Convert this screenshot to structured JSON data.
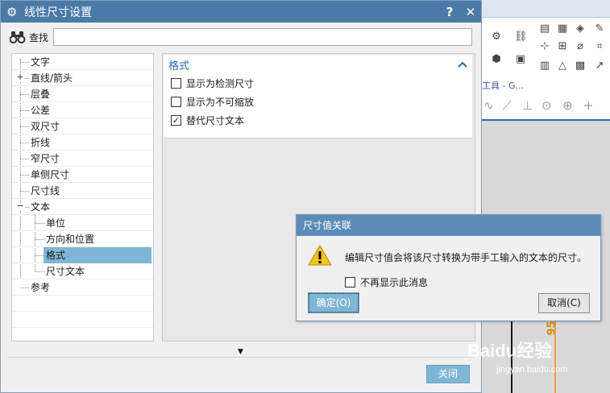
{
  "dialog": {
    "title": "线性尺寸设置",
    "help_label": "?",
    "close_label": "✕"
  },
  "search": {
    "label": "查找",
    "value": ""
  },
  "tree": {
    "items": [
      {
        "label": "文字",
        "level": 0
      },
      {
        "label": "直线/箭头",
        "level": 0,
        "expander": "+"
      },
      {
        "label": "层叠",
        "level": 0
      },
      {
        "label": "公差",
        "level": 0
      },
      {
        "label": "双尺寸",
        "level": 0
      },
      {
        "label": "折线",
        "level": 0
      },
      {
        "label": "窄尺寸",
        "level": 0
      },
      {
        "label": "单侧尺寸",
        "level": 0
      },
      {
        "label": "尺寸线",
        "level": 0
      },
      {
        "label": "文本",
        "level": 0,
        "expander": "−"
      },
      {
        "label": "单位",
        "level": 1
      },
      {
        "label": "方向和位置",
        "level": 1
      },
      {
        "label": "格式",
        "level": 1,
        "selected": true
      },
      {
        "label": "尺寸文本",
        "level": 1
      },
      {
        "label": "参考",
        "level": 0
      }
    ]
  },
  "format_group": {
    "title": "格式",
    "options": [
      {
        "label": "显示为检测尺寸",
        "checked": false
      },
      {
        "label": "显示为不可缩放",
        "checked": false
      },
      {
        "label": "替代尺寸文本",
        "checked": true
      }
    ]
  },
  "footer": {
    "close_label": "关闭"
  },
  "message": {
    "title": "尺寸值关联",
    "text": "编辑尺寸值会将该尺寸转换为带手工输入的文本的尺寸。",
    "checkbox_label": "不再显示此消息",
    "ok_label": "确定(O)",
    "cancel_label": "取消(C)"
  },
  "background": {
    "toolbar_label": "工具 - G...",
    "watermark_text": "Baidu经验",
    "watermark_url": "jingyan.baidu.com",
    "dimension_text": "95"
  },
  "colors": {
    "titlebar": "#4b7aa8",
    "accent": "#2a6db3",
    "selection": "#7fb6d5"
  }
}
